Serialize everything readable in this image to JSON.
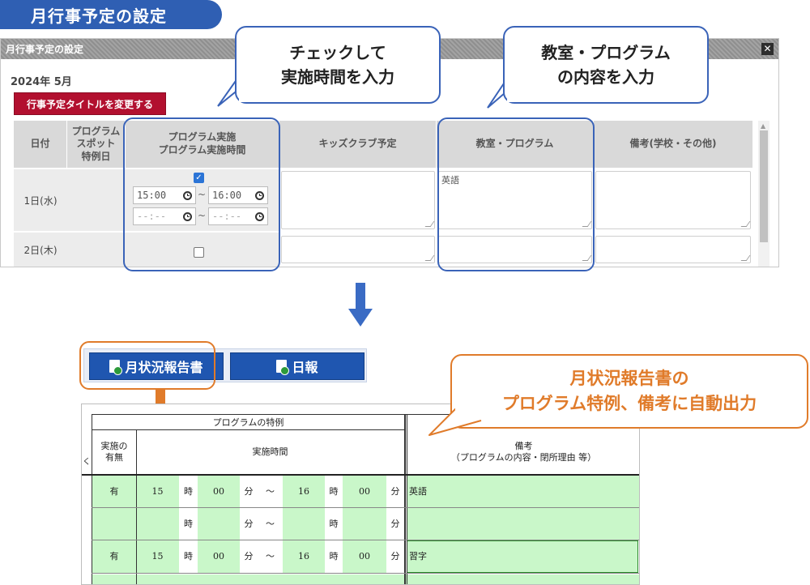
{
  "page_title": "月行事予定の設定",
  "dialog": {
    "title": "月行事予定の設定",
    "close": "✕",
    "month": "2024年 5月",
    "change_title_button": "行事予定タイトルを変更する",
    "columns": {
      "date": "日付",
      "spot": [
        "プログラム",
        "スポット",
        "特例日"
      ],
      "program_time": [
        "プログラム実施",
        "プログラム実施時間"
      ],
      "kids": "キッズクラブ予定",
      "classroom": "教室・プログラム",
      "notes": "備考(学校・その他)"
    },
    "rows": [
      {
        "date": "1日(水)",
        "checked": true,
        "start1": "15:00",
        "end1": "16:00",
        "start2": "--:--",
        "end2": "--:--",
        "classroom": "英語"
      },
      {
        "date": "2日(木)",
        "checked": false
      }
    ],
    "tilde": "~"
  },
  "bubbles": {
    "left": [
      "チェックして",
      "実施時間を入力"
    ],
    "right": [
      "教室・プログラム",
      "の内容を入力"
    ],
    "orange": [
      "月状況報告書の",
      "プログラム特例、備考に自動出力"
    ]
  },
  "report_buttons": {
    "monthly": "月状況報告書",
    "daily": "日報"
  },
  "sheet": {
    "header_program": "プログラムの特例",
    "header_done": [
      "実施の",
      "有無"
    ],
    "header_time": "実施時間",
    "header_notes": [
      "備考",
      "（プログラムの内容・閉所理由 等）"
    ],
    "side_char": "く",
    "units": {
      "hour": "時",
      "minute": "分",
      "tilde": "～"
    },
    "rows": [
      {
        "done": "有",
        "h1": "15",
        "m1": "00",
        "h2": "16",
        "m2": "00",
        "note": "英語"
      },
      {
        "done": "",
        "h1": "",
        "m1": "",
        "h2": "",
        "m2": "",
        "note": ""
      },
      {
        "done": "有",
        "h1": "15",
        "m1": "00",
        "h2": "16",
        "m2": "00",
        "note": "習字"
      }
    ]
  },
  "colors": {
    "brand_blue": "#2f5fb3",
    "highlight_orange": "#e07b2a",
    "button_red": "#b2102f",
    "sheet_green": "#c9f7c9"
  }
}
